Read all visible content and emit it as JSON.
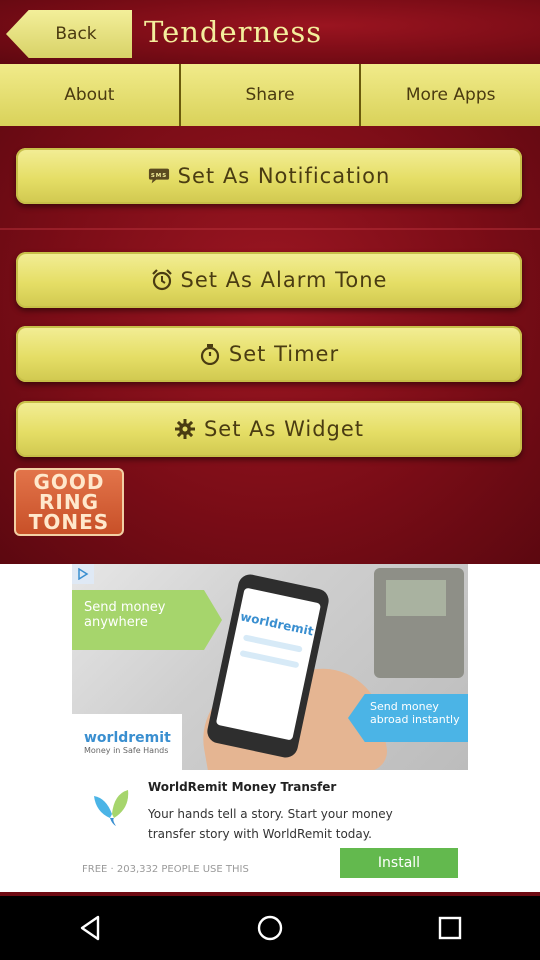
{
  "header": {
    "back_label": "Back",
    "title": "Tenderness"
  },
  "tabs": [
    {
      "label": "About"
    },
    {
      "label": "Share"
    },
    {
      "label": "More Apps"
    }
  ],
  "actions": {
    "notification": {
      "label": "Set As Notification",
      "icon": "sms-icon"
    },
    "alarm": {
      "label": "Set As Alarm Tone",
      "icon": "alarm-clock-icon"
    },
    "timer": {
      "label": "Set Timer",
      "icon": "stopwatch-icon"
    },
    "widget": {
      "label": "Set As Widget",
      "icon": "gear-icon"
    }
  },
  "logo": {
    "line1": "GOOD",
    "line2": "RING",
    "line3": "TONES"
  },
  "ad": {
    "bubble_left": "Send money anywhere",
    "bubble_right": "Send money abroad instantly",
    "phone_brand": "worldremit",
    "brand_logo": "worldremit",
    "brand_tagline": "Money in Safe Hands",
    "title": "WorldRemit Money Transfer",
    "description": "Your hands tell a story. Start your money transfer story with WorldRemit today.",
    "meta": "FREE · 203,332 PEOPLE USE THIS",
    "install_label": "Install",
    "colors": {
      "install": "#63b94e",
      "brand": "#3a8fd0"
    }
  },
  "colors": {
    "background": "#7c0d17",
    "button": "#e5de66",
    "title_text": "#f4ee9c"
  }
}
